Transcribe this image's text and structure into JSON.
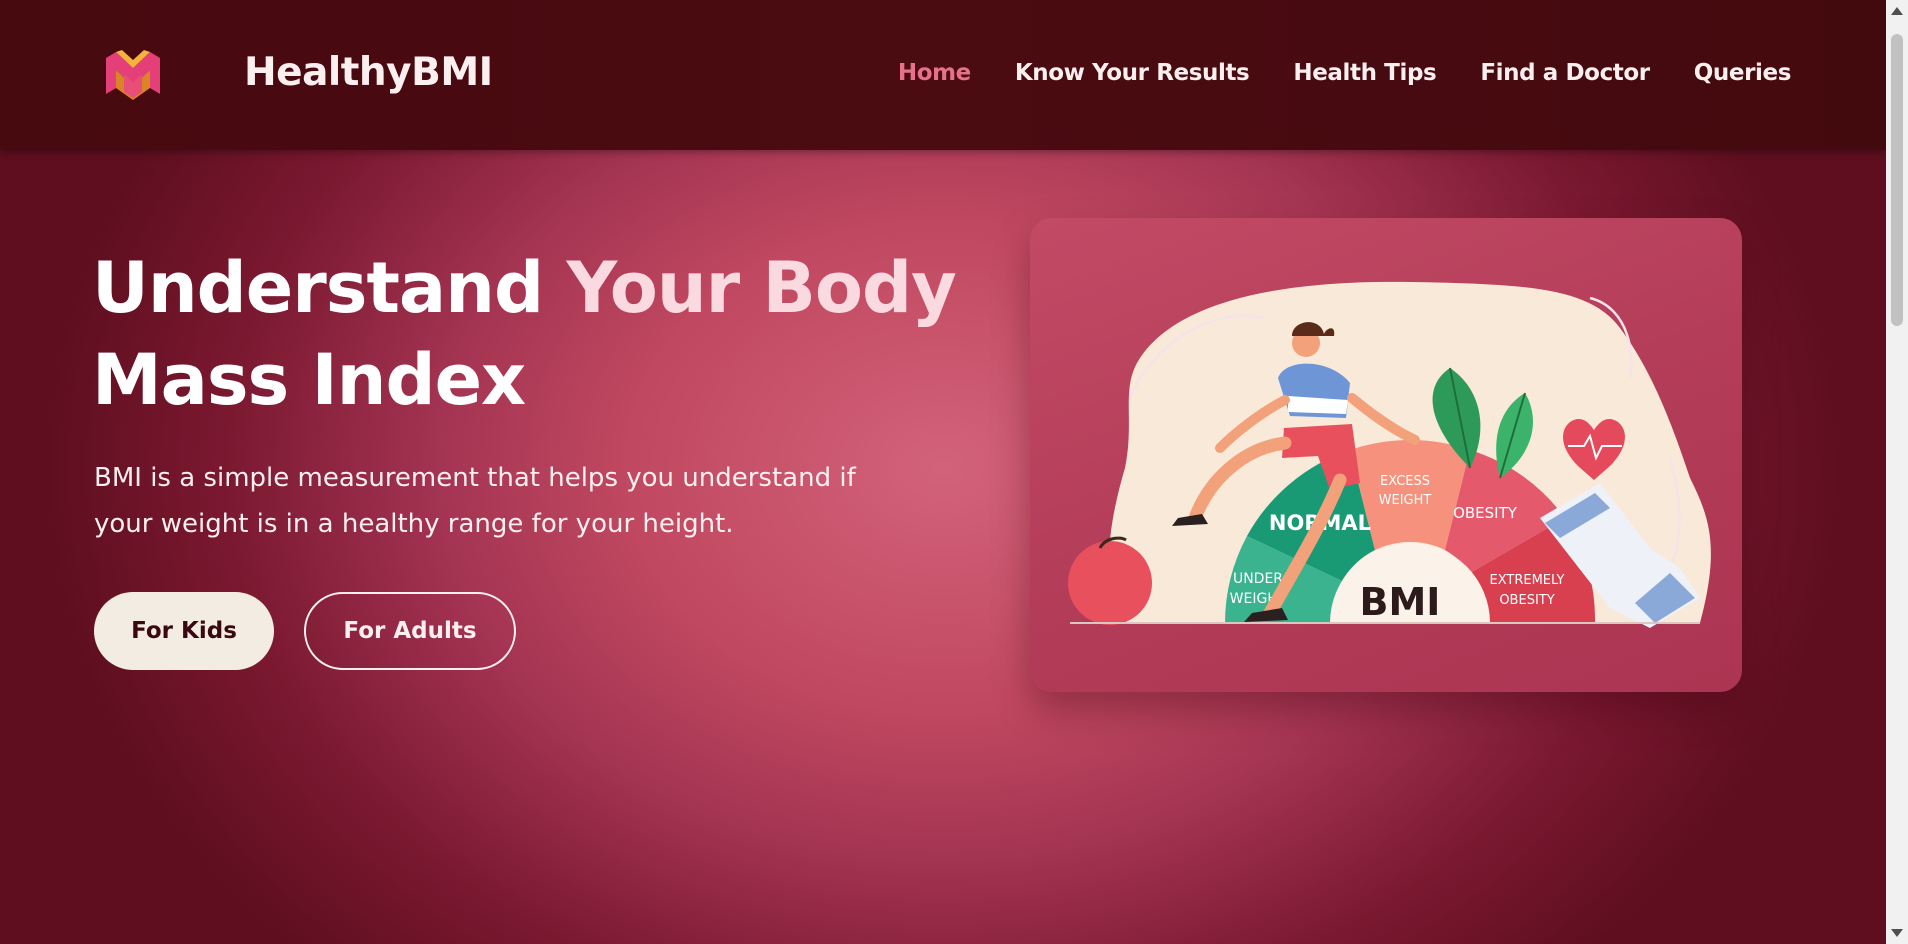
{
  "header": {
    "brand": "HealthyBMI",
    "logo_icon": "healthybmi-logo-icon",
    "nav": [
      {
        "label": "Home",
        "active": true
      },
      {
        "label": "Know Your Results",
        "active": false
      },
      {
        "label": "Health Tips",
        "active": false
      },
      {
        "label": "Find a Doctor",
        "active": false
      },
      {
        "label": "Queries",
        "active": false
      }
    ]
  },
  "hero": {
    "title_part1": "Understand",
    "title_part2": "Your Body",
    "title_part3": "Mass Index",
    "description": "BMI is a simple measurement that helps you understand if your weight is in a healthy range for your height.",
    "buttons": {
      "kids": "For Kids",
      "adults": "For Adults"
    }
  },
  "illustration": {
    "gauge_labels": {
      "under": [
        "UNDER",
        "WEIGHT"
      ],
      "normal": "NORMAL",
      "excess": [
        "EXCESS",
        "WEIGHT"
      ],
      "obesity": "OBESITY",
      "extreme": [
        "EXTREMELY",
        "OBESITY"
      ],
      "center": "BMI"
    }
  },
  "colors": {
    "header_bg": "#470a0f",
    "nav_active": "#e5718a",
    "hero_center": "#d2627a",
    "button_light": "#f3ece3"
  }
}
